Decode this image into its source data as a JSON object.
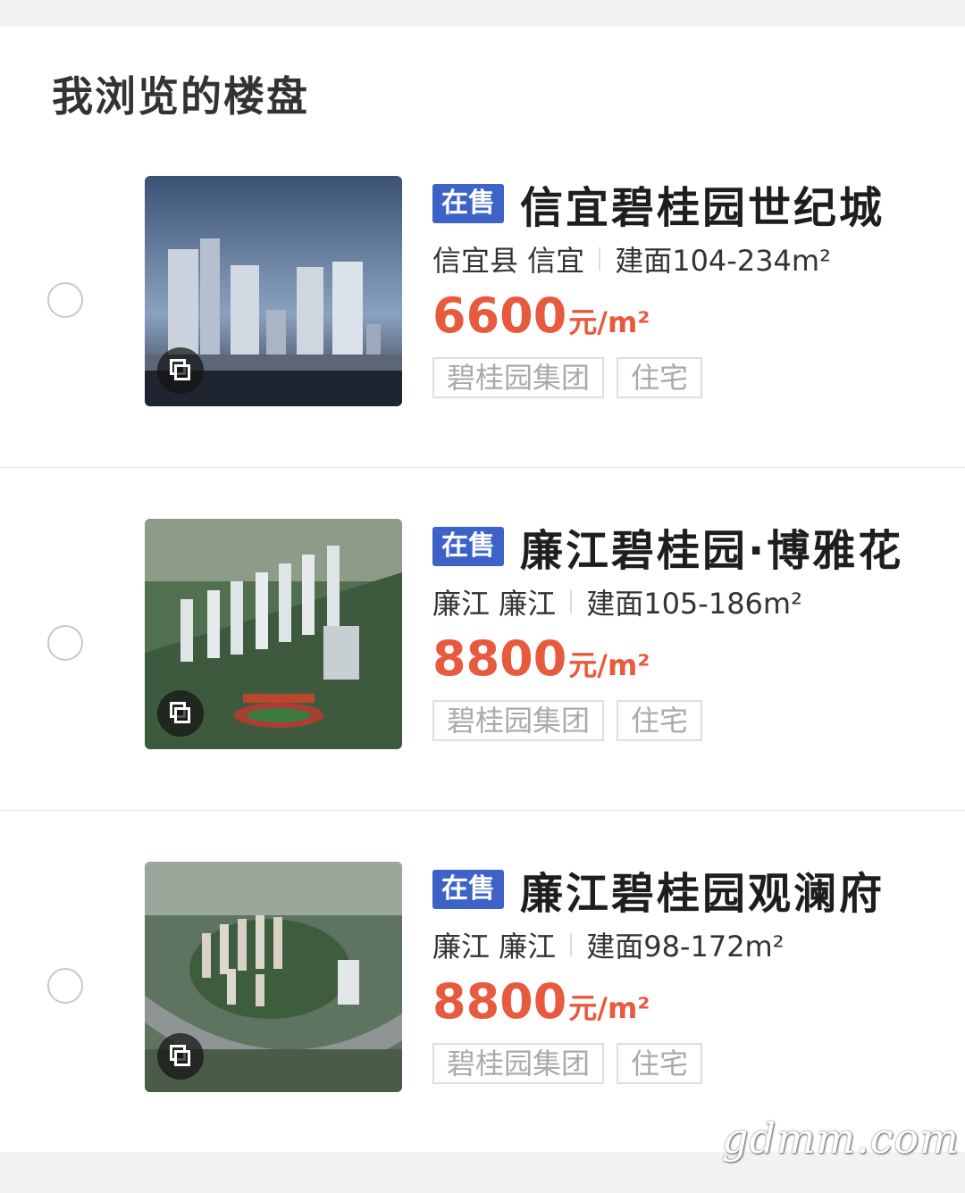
{
  "section": {
    "title": "我浏览的楼盘"
  },
  "listings": [
    {
      "status": "在售",
      "name": "信宜碧桂园世纪城",
      "district": "信宜县 信宜",
      "area_prefix": "建面",
      "area_range": "104-234",
      "area_unit": "m²",
      "price": "6600",
      "price_unit": "元/m²",
      "tags": [
        "碧桂园集团",
        "住宅"
      ],
      "image_icon": "gallery-icon"
    },
    {
      "status": "在售",
      "name": "廉江碧桂园·博雅花",
      "district": "廉江 廉江",
      "area_prefix": "建面",
      "area_range": "105-186",
      "area_unit": "m²",
      "price": "8800",
      "price_unit": "元/m²",
      "tags": [
        "碧桂园集团",
        "住宅"
      ],
      "image_icon": "gallery-icon"
    },
    {
      "status": "在售",
      "name": "廉江碧桂园观澜府",
      "district": "廉江 廉江",
      "area_prefix": "建面",
      "area_range": "98-172",
      "area_unit": "m²",
      "price": "8800",
      "price_unit": "元/m²",
      "tags": [
        "碧桂园集团",
        "住宅"
      ],
      "image_icon": "gallery-icon"
    }
  ],
  "watermark": "gdmm.com",
  "colors": {
    "status_badge": "#3d63c8",
    "price": "#e85a3e",
    "title": "#333333",
    "tag_text": "#aaaaaa"
  }
}
